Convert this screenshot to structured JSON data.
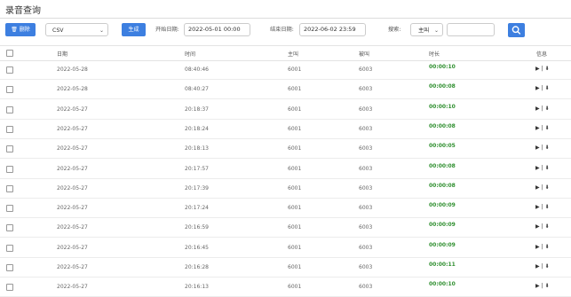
{
  "page": {
    "title": "录音查询"
  },
  "toolbar": {
    "delete_label": "删除",
    "format_value": "CSV",
    "generate_label": "生成",
    "start_label": "开始日期:",
    "start_value": "2022-05-01 00:00",
    "end_label": "结束日期:",
    "end_value": "2022-06-02 23:59",
    "search_label": "搜索:",
    "search_field_value": "主叫",
    "search_value": ""
  },
  "table": {
    "headers": {
      "date": "日期",
      "time": "时间",
      "caller": "主叫",
      "callee": "被叫",
      "duration": "时长",
      "info": "信息"
    },
    "rows": [
      {
        "date": "2022-05-28",
        "time": "08:40:46",
        "caller": "6001",
        "callee": "6003",
        "duration": "00:00:10",
        "actions": "▶ | ⬇"
      },
      {
        "date": "2022-05-28",
        "time": "08:40:27",
        "caller": "6001",
        "callee": "6003",
        "duration": "00:00:08",
        "actions": "▶ | ⬇"
      },
      {
        "date": "2022-05-27",
        "time": "20:18:37",
        "caller": "6001",
        "callee": "6003",
        "duration": "00:00:10",
        "actions": "▶ | ⬇"
      },
      {
        "date": "2022-05-27",
        "time": "20:18:24",
        "caller": "6001",
        "callee": "6003",
        "duration": "00:00:08",
        "actions": "▶ | ⬇"
      },
      {
        "date": "2022-05-27",
        "time": "20:18:13",
        "caller": "6001",
        "callee": "6003",
        "duration": "00:00:05",
        "actions": "▶ | ⬇"
      },
      {
        "date": "2022-05-27",
        "time": "20:17:57",
        "caller": "6001",
        "callee": "6003",
        "duration": "00:00:08",
        "actions": "▶ | ⬇"
      },
      {
        "date": "2022-05-27",
        "time": "20:17:39",
        "caller": "6001",
        "callee": "6003",
        "duration": "00:00:08",
        "actions": "▶ | ⬇"
      },
      {
        "date": "2022-05-27",
        "time": "20:17:24",
        "caller": "6001",
        "callee": "6003",
        "duration": "00:00:09",
        "actions": "▶ | ⬇"
      },
      {
        "date": "2022-05-27",
        "time": "20:16:59",
        "caller": "6001",
        "callee": "6003",
        "duration": "00:00:09",
        "actions": "▶ | ⬇"
      },
      {
        "date": "2022-05-27",
        "time": "20:16:45",
        "caller": "6001",
        "callee": "6003",
        "duration": "00:00:09",
        "actions": "▶ | ⬇"
      },
      {
        "date": "2022-05-27",
        "time": "20:16:28",
        "caller": "6001",
        "callee": "6003",
        "duration": "00:00:11",
        "actions": "▶ | ⬇"
      },
      {
        "date": "2022-05-27",
        "time": "20:16:13",
        "caller": "6001",
        "callee": "6003",
        "duration": "00:00:10",
        "actions": "▶ | ⬇"
      }
    ]
  },
  "colors": {
    "accent": "#3d7fe0",
    "duration": "#2f8f2f"
  },
  "icons": {
    "delete": "trash-icon",
    "search": "search-icon",
    "play": "play-icon",
    "download": "download-icon"
  }
}
